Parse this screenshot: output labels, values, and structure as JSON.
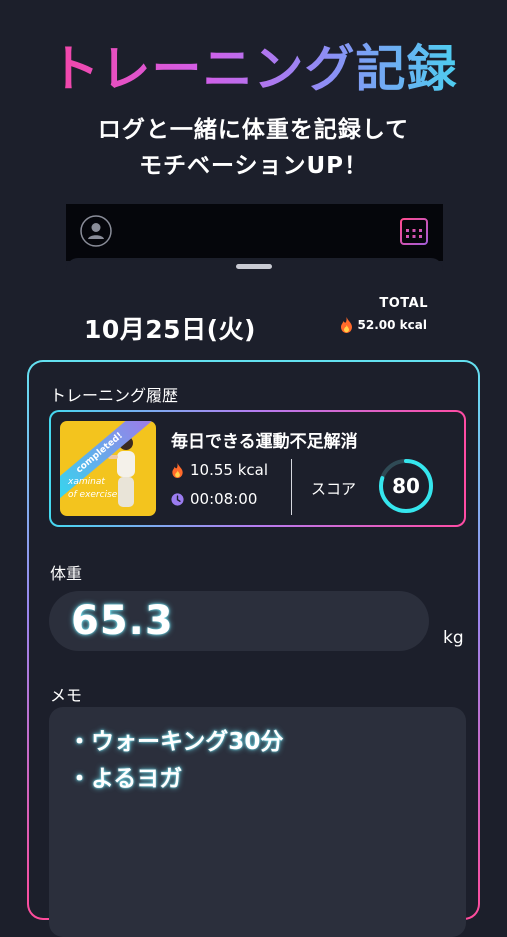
{
  "hero": {
    "title": "トレーニング記録",
    "subtitle_line1": "ログと一緒に体重を記録して",
    "subtitle_line2": "モチベーションUP！"
  },
  "topbar": {
    "profile_icon": "user-circle-icon",
    "calendar_icon": "calendar-icon"
  },
  "header": {
    "date": "10月25日(火)",
    "total_label": "TOTAL",
    "total_value": "52.00 kcal"
  },
  "history": {
    "label": "トレーニング履歴",
    "card": {
      "thumb_badge": "completed!",
      "thumb_caption_1": "xaminat",
      "thumb_caption_2": "of exercise",
      "title": "毎日できる運動不足解消",
      "kcal": "10.55 kcal",
      "time": "00:08:00",
      "score_label": "スコア",
      "score": "80",
      "score_fraction": 0.8
    }
  },
  "weight": {
    "label": "体重",
    "value": "65.3",
    "unit": "kg"
  },
  "memo": {
    "label": "メモ",
    "lines": [
      "・ウォーキング30分",
      "・よるヨガ"
    ]
  },
  "colors": {
    "background": "#1c1f2b",
    "accent_cyan": "#35e6ee",
    "accent_pink": "#ff3d8f",
    "flame": "#ff6a2b",
    "clock": "#9b7cf0"
  }
}
